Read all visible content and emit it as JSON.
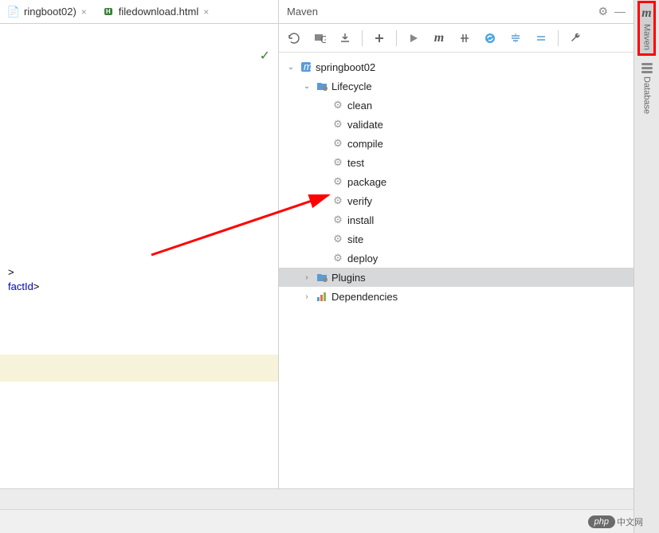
{
  "tabs": [
    {
      "label": "ringboot02)",
      "icon": "module"
    },
    {
      "label": "filedownload.html",
      "icon": "html"
    }
  ],
  "editor": {
    "status_check": "✓",
    "code_lines": [
      {
        "segments": [
          {
            "text": ">",
            "class": ""
          }
        ]
      },
      {
        "segments": [
          {
            "text": "factId",
            "class": "code-blue"
          },
          {
            "text": ">",
            "class": ""
          }
        ]
      }
    ]
  },
  "panel": {
    "title": "Maven",
    "toolbar_icons": [
      "refresh",
      "generate",
      "download",
      "add",
      "sep",
      "run",
      "m",
      "skip",
      "sync",
      "expand",
      "collapse",
      "sep",
      "wrench"
    ]
  },
  "tree": {
    "root": {
      "label": "springboot02",
      "expanded": true,
      "children": [
        {
          "label": "Lifecycle",
          "icon": "folder",
          "expanded": true,
          "children": [
            {
              "label": "clean",
              "icon": "gear"
            },
            {
              "label": "validate",
              "icon": "gear"
            },
            {
              "label": "compile",
              "icon": "gear"
            },
            {
              "label": "test",
              "icon": "gear"
            },
            {
              "label": "package",
              "icon": "gear"
            },
            {
              "label": "verify",
              "icon": "gear"
            },
            {
              "label": "install",
              "icon": "gear"
            },
            {
              "label": "site",
              "icon": "gear"
            },
            {
              "label": "deploy",
              "icon": "gear"
            }
          ]
        },
        {
          "label": "Plugins",
          "icon": "folder",
          "expanded": false,
          "selected": true
        },
        {
          "label": "Dependencies",
          "icon": "deps",
          "expanded": false
        }
      ]
    }
  },
  "right_strip": [
    {
      "id": "maven",
      "label": "Maven",
      "highlighted": true
    },
    {
      "id": "database",
      "label": "Database",
      "highlighted": false
    }
  ],
  "watermark": {
    "badge": "php",
    "text": "中文网"
  },
  "annotation": {
    "arrow_target": "package"
  }
}
